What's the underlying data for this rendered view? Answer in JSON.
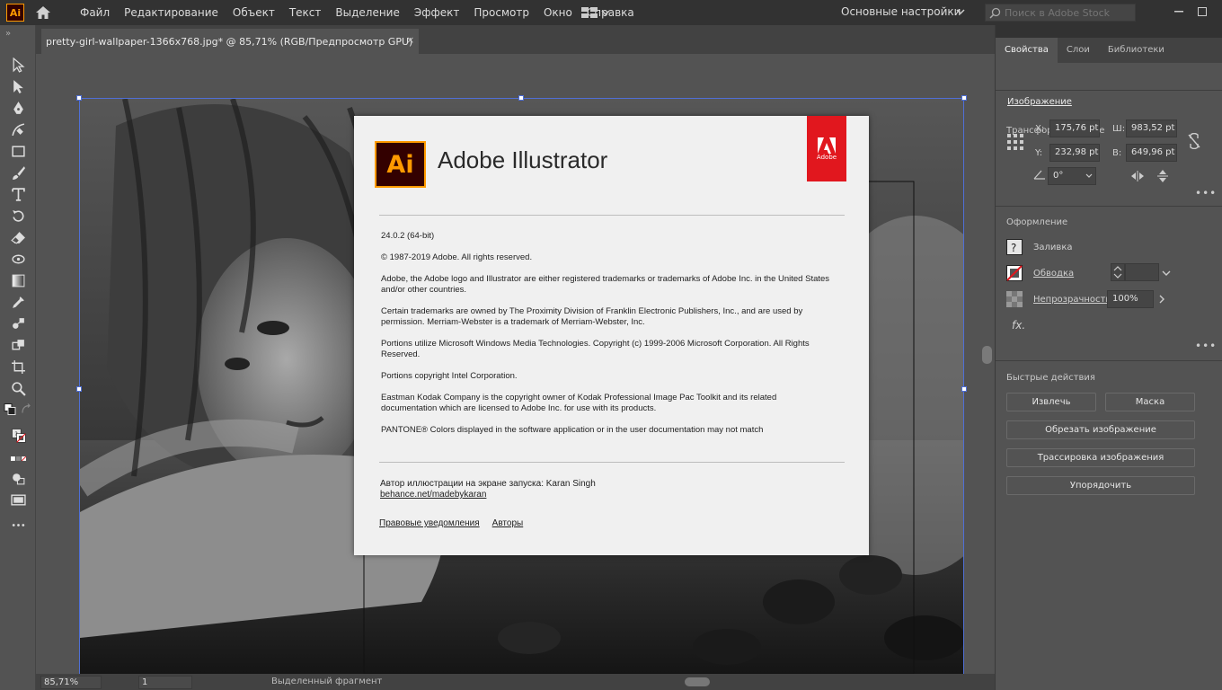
{
  "app": {
    "logo_text": "Ai",
    "accent_color": "#ff9a00"
  },
  "menu": {
    "items": [
      "Файл",
      "Редактирование",
      "Объект",
      "Текст",
      "Выделение",
      "Эффект",
      "Просмотр",
      "Окно",
      "Справка"
    ],
    "workspace": "Основные настройки",
    "search_placeholder": "Поиск в Adobe Stock"
  },
  "document": {
    "tab_title": "pretty-girl-wallpaper-1366x768.jpg* @ 85,71% (RGB/Предпросмотр GPU)",
    "close_glyph": "×"
  },
  "status": {
    "zoom": "85,71%",
    "artboard": "1",
    "tool_status": "Выделенный фрагмент"
  },
  "panel": {
    "tabs": [
      "Свойства",
      "Слои",
      "Библиотеки"
    ],
    "active_tab": 0,
    "object_type": "Изображение",
    "transform": {
      "title": "Трансформирование",
      "x_label": "X:",
      "x": "175,76 pt",
      "y_label": "Y:",
      "y": "232,98 pt",
      "w_label": "Ш:",
      "w": "983,52 pt",
      "h_label": "В:",
      "h": "649,96 pt",
      "angle": "0°"
    },
    "appearance": {
      "title": "Оформление",
      "fill_label": "Заливка",
      "stroke_label": "Обводка",
      "opacity_label": "Непрозрачность",
      "opacity": "100%",
      "fx": "fx."
    },
    "quick_actions": {
      "title": "Быстрые действия",
      "embed": "Извлечь",
      "mask": "Маска",
      "crop": "Обрезать изображение",
      "trace": "Трассировка изображения",
      "arrange": "Упорядочить"
    }
  },
  "about": {
    "logo_text": "Ai",
    "title": "Adobe Illustrator",
    "brand_tag": "Adobe",
    "version": "24.0.2 (64-bit)",
    "paragraphs": [
      "© 1987-2019 Adobe. All rights reserved.",
      "Adobe, the Adobe logo and Illustrator are either registered trademarks or trademarks of Adobe Inc. in the United States and/or other countries.",
      "Certain trademarks are owned by The Proximity Division of Franklin Electronic Publishers, Inc., and are used by permission. Merriam-Webster is a trademark of Merriam-Webster, Inc.",
      "Portions utilize Microsoft Windows Media Technologies. Copyright (c) 1999-2006 Microsoft Corporation. All Rights Reserved.",
      "Portions copyright Intel Corporation.",
      "Eastman Kodak Company is the copyright owner of Kodak Professional Image Pac Toolkit and its related documentation which are licensed to Adobe Inc. for use with its products.",
      "PANTONE® Colors displayed in the software application or in the user documentation may not match"
    ],
    "credit": "Автор иллюстрации на экране запуска: Karan Singh",
    "credit_link": "behance.net/madebykaran",
    "legal_link": "Правовые уведомления",
    "authors_link": "Авторы"
  }
}
